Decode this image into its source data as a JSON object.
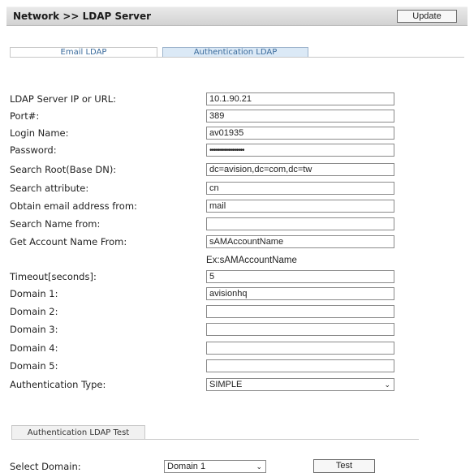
{
  "header": {
    "title": "Network >> LDAP Server",
    "update_label": "Update"
  },
  "tabs": [
    {
      "label": "Email LDAP"
    },
    {
      "label": "Authentication LDAP"
    }
  ],
  "form": {
    "ldap_server": {
      "label": "LDAP Server IP or URL:",
      "value": "10.1.90.21"
    },
    "port": {
      "label": "Port#:",
      "value": "389"
    },
    "login_name": {
      "label": "Login Name:",
      "value": "av01935"
    },
    "password": {
      "label": "Password:",
      "value": "•••••••••••••••••"
    },
    "search_root": {
      "label": "Search Root(Base DN):",
      "value": "dc=avision,dc=com,dc=tw"
    },
    "search_attribute": {
      "label": "Search attribute:",
      "value": "cn"
    },
    "obtain_email": {
      "label": "Obtain email address from:",
      "value": "mail"
    },
    "search_name": {
      "label": "Search Name from:",
      "value": ""
    },
    "account_name": {
      "label": "Get Account Name From:",
      "value": "sAMAccountName",
      "hint": "Ex:sAMAccountName"
    },
    "timeout": {
      "label": "Timeout[seconds]:",
      "value": "5"
    },
    "domain1": {
      "label": "Domain 1:",
      "value": "avisionhq"
    },
    "domain2": {
      "label": "Domain 2:",
      "value": ""
    },
    "domain3": {
      "label": "Domain 3:",
      "value": ""
    },
    "domain4": {
      "label": "Domain 4:",
      "value": ""
    },
    "domain5": {
      "label": "Domain 5:",
      "value": ""
    },
    "auth_type": {
      "label": "Authentication Type:",
      "value": "SIMPLE"
    }
  },
  "test_section": {
    "tab_label": "Authentication LDAP Test",
    "select_domain_label": "Select Domain:",
    "domain_value": "Domain 1",
    "test_label": "Test"
  },
  "icons": {
    "dropdown": "chevron-down-icon"
  }
}
